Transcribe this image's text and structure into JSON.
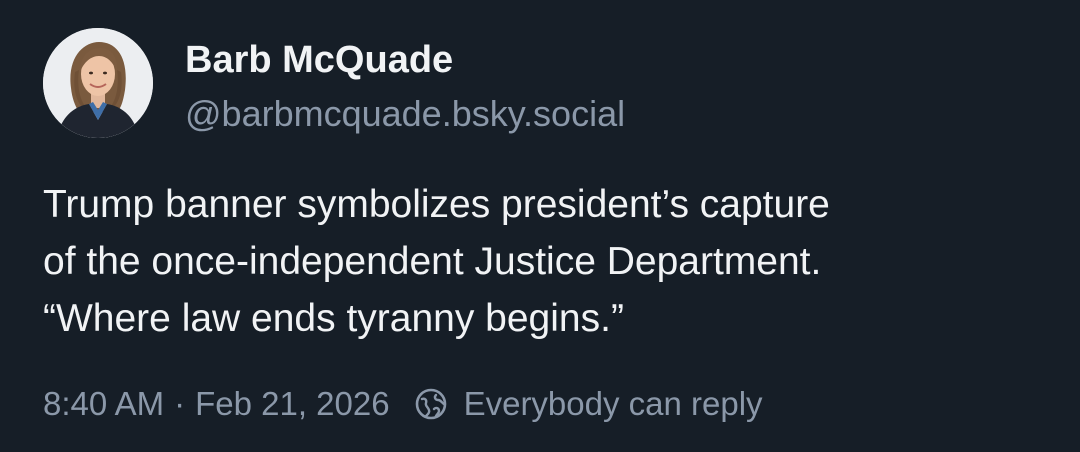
{
  "post": {
    "author": {
      "display_name": "Barb McQuade",
      "handle": "@barbmcquade.bsky.social",
      "avatar_icon": "profile-photo"
    },
    "text_lines": [
      "Trump banner symbolizes president’s capture",
      "of the once-independent Justice Department.",
      "“Where law ends tyranny begins.”"
    ],
    "meta": {
      "time": "8:40 AM",
      "separator": "·",
      "date": "Feb 21, 2026",
      "reply_icon": "globe-icon",
      "reply_setting": "Everybody can reply"
    }
  },
  "colors": {
    "background": "#161e27",
    "primary_text": "#f1f3f5",
    "secondary_text": "#8b98a9"
  }
}
